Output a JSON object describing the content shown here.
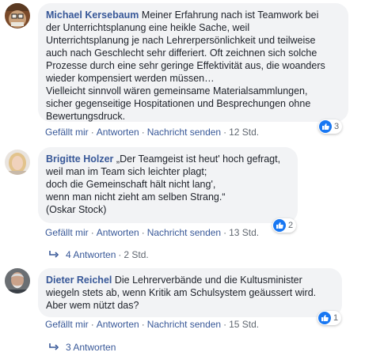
{
  "comments": [
    {
      "author": "Michael Kersebaum",
      "text": "Meiner Erfahrung nach ist Teamwork bei\nder Unterrichtsplanung eine heikle Sache, weil\nUnterrichtsplanung je nach Lehrerpersönlichkeit und teilweise\nauch nach Geschlecht sehr differiert. Oft zeichnen sich solche\nProzesse durch eine sehr geringe Effektivität aus, die woanders\nwieder kompensiert werden müssen…\nVielleicht sinnvoll wären gemeinsame Materialsammlungen,\nsicher gegenseitige Hospitationen und Besprechungen ohne\nBewertungsdruck.",
      "like": "Gefällt mir",
      "reply": "Antworten",
      "message": "Nachricht senden",
      "time": "12 Std.",
      "reaction_count": "3"
    },
    {
      "author": "Brigitte Holzer",
      "text": "„Der Teamgeist ist heut' hoch gefragt,\nweil man im Team sich leichter plagt;\ndoch die Gemeinschaft hält nicht lang',\nwenn man nicht zieht am selben Strang.“\n(Oskar Stock)",
      "like": "Gefällt mir",
      "reply": "Antworten",
      "message": "Nachricht senden",
      "time": "13 Std.",
      "reaction_count": "2",
      "replies_label": "4 Antworten",
      "replies_time": "2 Std."
    },
    {
      "author": "Dieter Reichel",
      "text": "Die Lehrerverbände und die Kultusminister\nwiegeln stets ab, wenn Kritik am Schulsystem geäussert wird.\nAber wem nützt das?",
      "like": "Gefällt mir",
      "reply": "Antworten",
      "message": "Nachricht senden",
      "time": "15 Std.",
      "reaction_count": "1",
      "replies_label": "3 Antworten"
    }
  ],
  "separator": "·",
  "colors": {
    "link": "#385898",
    "bubble": "#f2f3f5",
    "like_blue": "#1877f2",
    "meta": "#606770"
  }
}
